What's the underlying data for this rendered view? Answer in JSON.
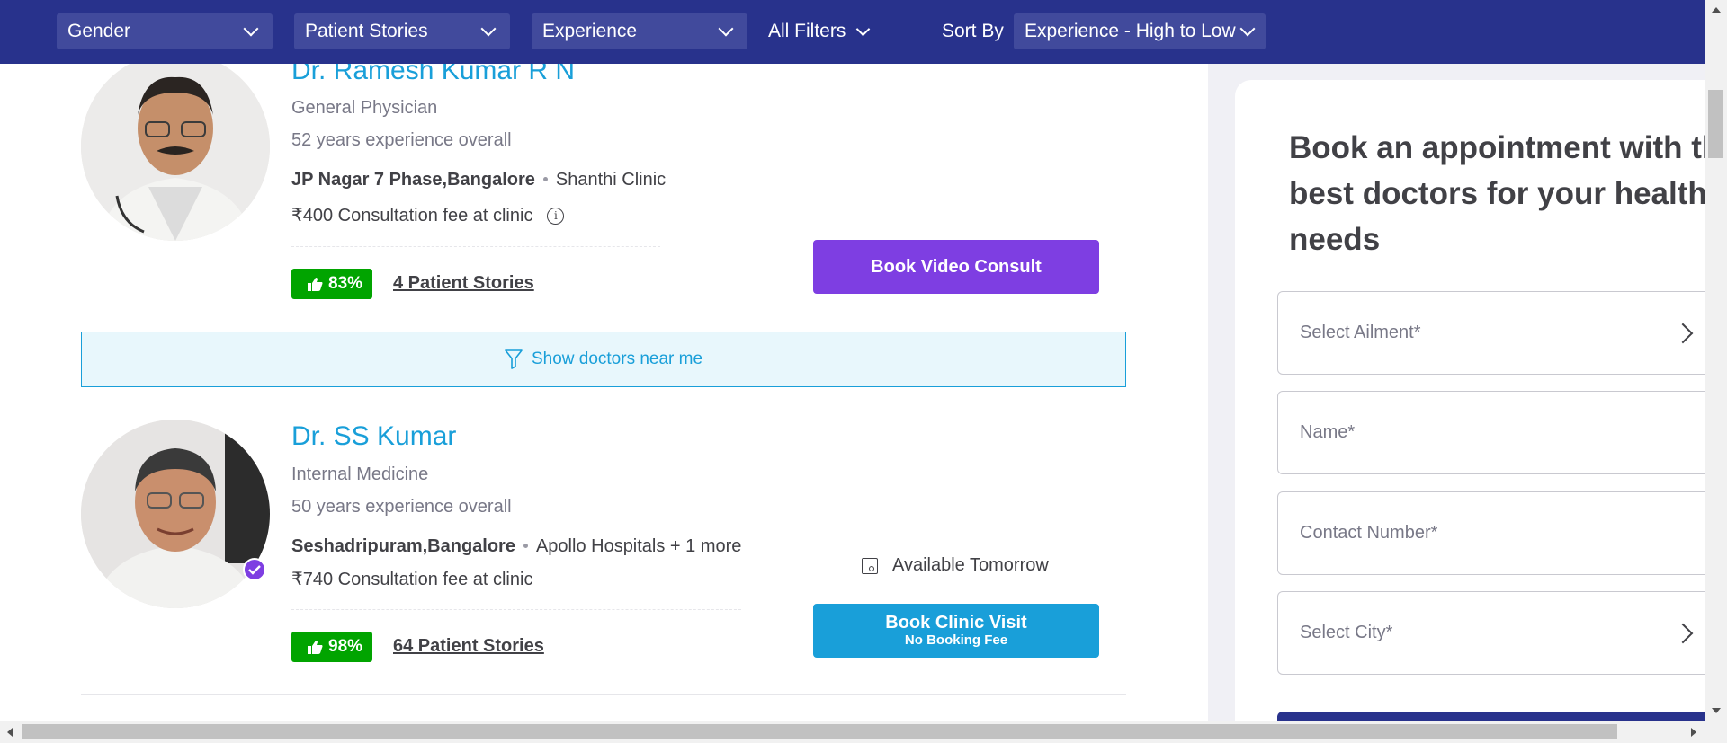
{
  "filters": {
    "gender": "Gender",
    "patient_stories": "Patient Stories",
    "experience": "Experience",
    "all_filters": "All Filters",
    "sort_by_label": "Sort By",
    "sort_by_value": "Experience - High to Low"
  },
  "doctors": [
    {
      "name": "Dr. Ramesh Kumar R N",
      "specialty": "General Physician",
      "experience": "52 years experience overall",
      "locality": "JP Nagar 7 Phase,Bangalore",
      "clinic": "Shanthi Clinic",
      "fee": "₹400 Consultation fee at clinic",
      "rating": "83%",
      "stories": "4 Patient Stories",
      "button": "Book Video Consult"
    },
    {
      "name": "Dr. SS Kumar",
      "specialty": "Internal Medicine",
      "experience": "50 years experience overall",
      "locality": "Seshadripuram,Bangalore",
      "clinic": "Apollo Hospitals + 1 more",
      "fee": "₹740 Consultation fee at clinic",
      "rating": "98%",
      "stories": "64 Patient Stories",
      "availability": "Available Tomorrow",
      "button": "Book Clinic Visit",
      "button_sub": "No Booking Fee"
    }
  ],
  "near_me": "Show doctors near me",
  "appointment": {
    "title_line1": "Book an appointment with th",
    "title_line2": "best doctors for your health",
    "title_line3": "needs",
    "ailment_placeholder": "Select Ailment*",
    "name_placeholder": "Name*",
    "contact_placeholder": "Contact Number*",
    "city_placeholder": "Select City*"
  },
  "colors": {
    "topbar": "#28328c",
    "link_blue": "#199fd9",
    "video_purple": "#7e3ee2",
    "rating_green": "#01a400"
  }
}
